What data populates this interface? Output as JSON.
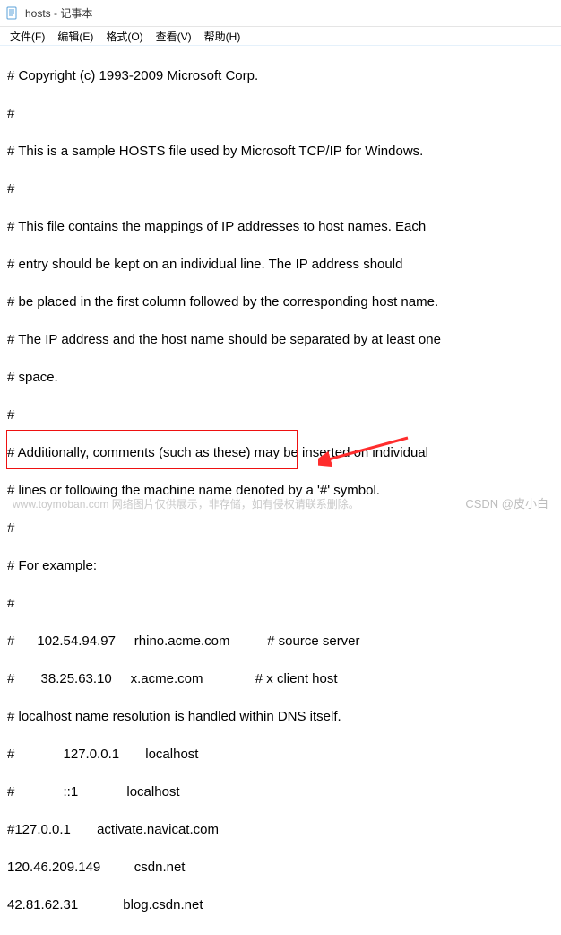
{
  "window": {
    "title": "hosts - 记事本"
  },
  "menu": {
    "file": "文件(F)",
    "edit": "编辑(E)",
    "format": "格式(O)",
    "view": "查看(V)",
    "help": "帮助(H)"
  },
  "body": {
    "l1": "# Copyright (c) 1993-2009 Microsoft Corp.",
    "l2": "#",
    "l3": "# This is a sample HOSTS file used by Microsoft TCP/IP for Windows.",
    "l4": "#",
    "l5": "# This file contains the mappings of IP addresses to host names. Each",
    "l6": "# entry should be kept on an individual line. The IP address should",
    "l7": "# be placed in the first column followed by the corresponding host name.",
    "l8": "# The IP address and the host name should be separated by at least one",
    "l9": "# space.",
    "l10": "#",
    "l11": "# Additionally, comments (such as these) may be inserted on individual",
    "l12": "# lines or following the machine name denoted by a '#' symbol.",
    "l13": "#",
    "l14": "# For example:",
    "l15": "#",
    "l16": "#      102.54.94.97     rhino.acme.com          # source server",
    "l17": "#       38.25.63.10     x.acme.com              # x client host",
    "l18": "# localhost name resolution is handled within DNS itself.",
    "l19": "#             127.0.0.1       localhost",
    "l20": "#             ::1             localhost",
    "l21": "#127.0.0.1       activate.navicat.com",
    "l22": "120.46.209.149         csdn.net",
    "l23": "42.81.62.31            blog.csdn.net"
  },
  "watermark": {
    "left": "www.toymoban.com  网络图片仅供展示，非存储，如有侵权请联系删除。",
    "right": "CSDN @皮小白"
  },
  "annotation": {
    "arrow_color": "#ff2d2d",
    "box_color": "#e11"
  }
}
